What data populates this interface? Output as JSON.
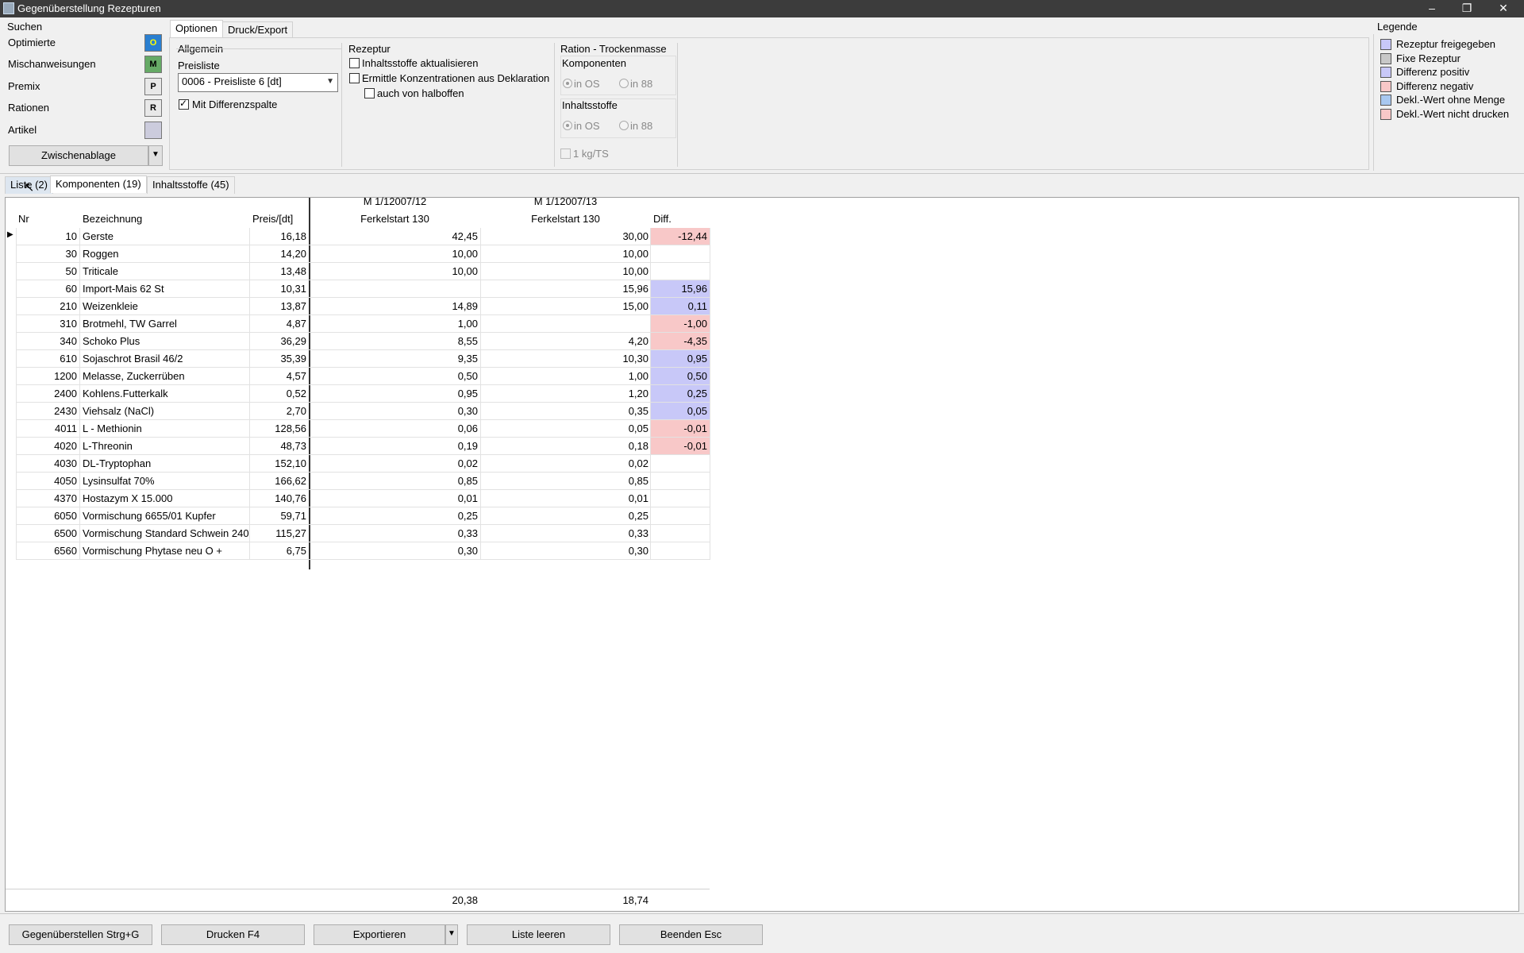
{
  "window": {
    "title": "Gegenüberstellung Rezepturen",
    "min": "–",
    "max": "❐",
    "close": "✕"
  },
  "search": {
    "title": "Suchen",
    "items": [
      {
        "label": "Optimierte",
        "icon": "O"
      },
      {
        "label": "Mischanweisungen",
        "icon": "M"
      },
      {
        "label": "Premix",
        "icon": "P"
      },
      {
        "label": "Rationen",
        "icon": "R"
      },
      {
        "label": "Artikel",
        "icon": ""
      }
    ],
    "clipboard": "Zwischenablage"
  },
  "options_tabs": [
    "Optionen",
    "Druck/Export"
  ],
  "allgemein": {
    "title": "Allgemein",
    "preisliste_label": "Preisliste",
    "preisliste_value": "0006 - Preisliste 6 [dt]",
    "diffspalte": "Mit Differenzspalte"
  },
  "rezeptur": {
    "title": "Rezeptur",
    "opt1": "Inhaltsstoffe aktualisieren",
    "opt2": "Ermittle Konzentrationen aus Deklaration",
    "opt3": "auch von halboffen"
  },
  "ration": {
    "title": "Ration - Trockenmasse",
    "komponenten": "Komponenten",
    "inhaltsstoffe": "Inhaltsstoffe",
    "in_os": "in OS",
    "in_88": "in 88",
    "kgts": "1 kg/TS"
  },
  "legend": {
    "title": "Legende",
    "items": [
      {
        "label": "Rezeptur freigegeben",
        "color": "#c8c8f8"
      },
      {
        "label": "Fixe Rezeptur",
        "color": "#c8c8c8"
      },
      {
        "label": "Differenz positiv",
        "color": "#c8c8f8"
      },
      {
        "label": "Differenz negativ",
        "color": "#f8c8c8"
      },
      {
        "label": "Dekl.-Wert ohne Menge",
        "color": "#a8c8f0"
      },
      {
        "label": "Dekl.-Wert nicht drucken",
        "color": "#f8c8c8"
      }
    ]
  },
  "main_tabs": [
    "Liste (2)",
    "Komponenten (19)",
    "Inhaltsstoffe (45)"
  ],
  "table": {
    "headers": {
      "nr": "Nr",
      "bez": "Bezeichnung",
      "preis": "Preis/[dt]",
      "r1_code": "M 1/12007/12",
      "r1_name": "Ferkelstart 130",
      "r2_code": "M 1/12007/13",
      "r2_name": "Ferkelstart 130",
      "diff": "Diff."
    },
    "rows": [
      {
        "nr": "10",
        "bez": "Gerste",
        "preis": "16,18",
        "r1": "42,45",
        "r2": "30,00",
        "diff": "-12,44",
        "sign": "neg"
      },
      {
        "nr": "30",
        "bez": "Roggen",
        "preis": "14,20",
        "r1": "10,00",
        "r2": "10,00",
        "diff": "",
        "sign": ""
      },
      {
        "nr": "50",
        "bez": "Triticale",
        "preis": "13,48",
        "r1": "10,00",
        "r2": "10,00",
        "diff": "",
        "sign": ""
      },
      {
        "nr": "60",
        "bez": "Import-Mais 62 St",
        "preis": "10,31",
        "r1": "",
        "r2": "15,96",
        "diff": "15,96",
        "sign": "pos"
      },
      {
        "nr": "210",
        "bez": "Weizenkleie",
        "preis": "13,87",
        "r1": "14,89",
        "r2": "15,00",
        "diff": "0,11",
        "sign": "pos"
      },
      {
        "nr": "310",
        "bez": "Brotmehl, TW Garrel",
        "preis": "4,87",
        "r1": "1,00",
        "r2": "",
        "diff": "-1,00",
        "sign": "neg"
      },
      {
        "nr": "340",
        "bez": "Schoko Plus",
        "preis": "36,29",
        "r1": "8,55",
        "r2": "4,20",
        "diff": "-4,35",
        "sign": "neg"
      },
      {
        "nr": "610",
        "bez": "Sojaschrot Brasil 46/2",
        "preis": "35,39",
        "r1": "9,35",
        "r2": "10,30",
        "diff": "0,95",
        "sign": "pos"
      },
      {
        "nr": "1200",
        "bez": "Melasse, Zuckerrüben",
        "preis": "4,57",
        "r1": "0,50",
        "r2": "1,00",
        "diff": "0,50",
        "sign": "pos"
      },
      {
        "nr": "2400",
        "bez": "Kohlens.Futterkalk",
        "preis": "0,52",
        "r1": "0,95",
        "r2": "1,20",
        "diff": "0,25",
        "sign": "pos"
      },
      {
        "nr": "2430",
        "bez": "Viehsalz (NaCl)",
        "preis": "2,70",
        "r1": "0,30",
        "r2": "0,35",
        "diff": "0,05",
        "sign": "pos"
      },
      {
        "nr": "4011",
        "bez": "L - Methionin",
        "preis": "128,56",
        "r1": "0,06",
        "r2": "0,05",
        "diff": "-0,01",
        "sign": "neg"
      },
      {
        "nr": "4020",
        "bez": "L-Threonin",
        "preis": "48,73",
        "r1": "0,19",
        "r2": "0,18",
        "diff": "-0,01",
        "sign": "neg"
      },
      {
        "nr": "4030",
        "bez": "DL-Tryptophan",
        "preis": "152,10",
        "r1": "0,02",
        "r2": "0,02",
        "diff": "",
        "sign": ""
      },
      {
        "nr": "4050",
        "bez": "Lysinsulfat 70%",
        "preis": "166,62",
        "r1": "0,85",
        "r2": "0,85",
        "diff": "",
        "sign": ""
      },
      {
        "nr": "4370",
        "bez": "Hostazym X 15.000",
        "preis": "140,76",
        "r1": "0,01",
        "r2": "0,01",
        "diff": "",
        "sign": ""
      },
      {
        "nr": "6050",
        "bez": "Vormischung 6655/01 Kupfer",
        "preis": "59,71",
        "r1": "0,25",
        "r2": "0,25",
        "diff": "",
        "sign": ""
      },
      {
        "nr": "6500",
        "bez": "Vormischung Standard Schwein 240",
        "preis": "115,27",
        "r1": "0,33",
        "r2": "0,33",
        "diff": "",
        "sign": ""
      },
      {
        "nr": "6560",
        "bez": "Vormischung Phytase neu O +",
        "preis": "6,75",
        "r1": "0,30",
        "r2": "0,30",
        "diff": "",
        "sign": ""
      }
    ],
    "totals": {
      "r1": "20,38",
      "r2": "18,74"
    }
  },
  "bottom_buttons": {
    "compare": "Gegenüberstellen Strg+G",
    "print": "Drucken F4",
    "export": "Exportieren",
    "clear": "Liste leeren",
    "quit": "Beenden Esc"
  }
}
